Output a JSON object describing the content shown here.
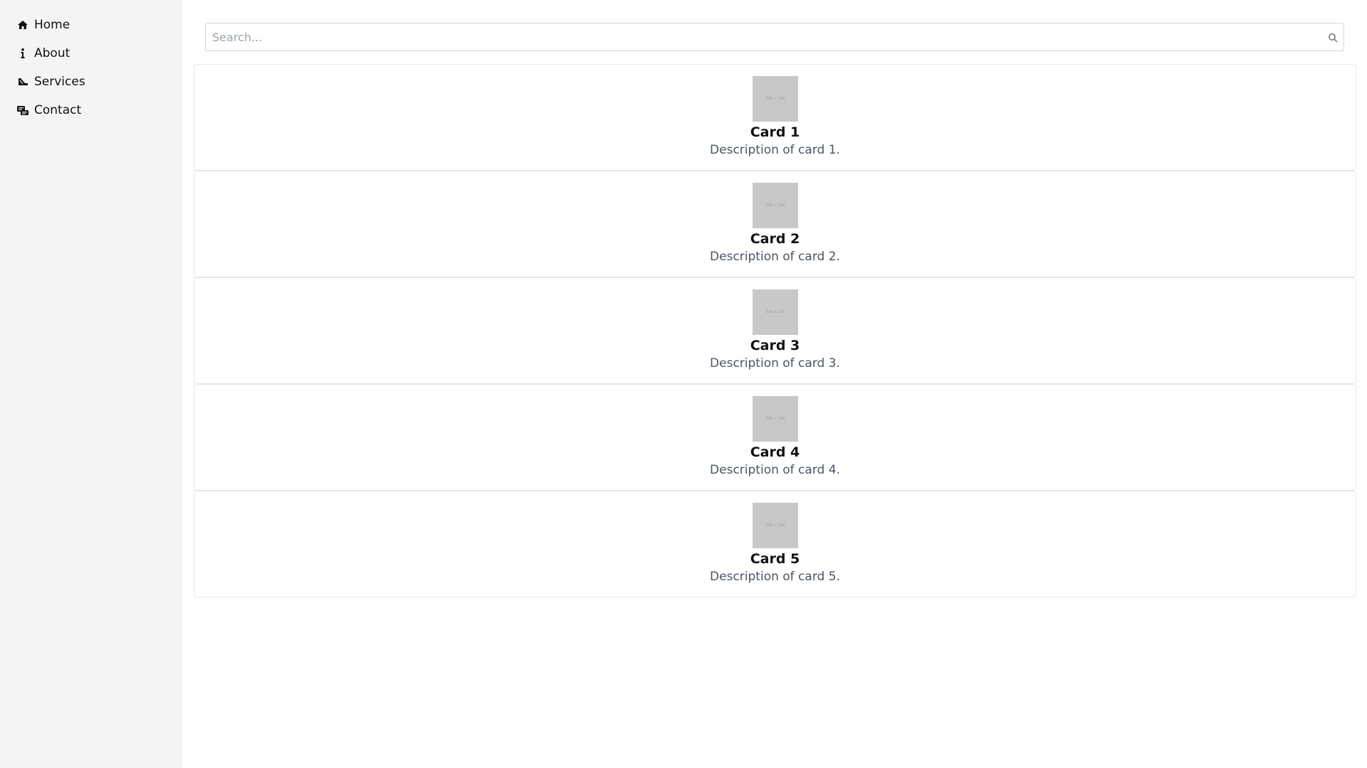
{
  "sidebar": {
    "items": [
      {
        "label": "Home",
        "icon": "home-icon"
      },
      {
        "label": "About",
        "icon": "info-icon"
      },
      {
        "label": "Services",
        "icon": "services-icon"
      },
      {
        "label": "Contact",
        "icon": "contact-icon"
      }
    ]
  },
  "search": {
    "placeholder": "Search...",
    "value": ""
  },
  "cards": [
    {
      "title": "Card 1",
      "description": "Description of card 1.",
      "image_text": "150 × 150"
    },
    {
      "title": "Card 2",
      "description": "Description of card 2.",
      "image_text": "150 × 150"
    },
    {
      "title": "Card 3",
      "description": "Description of card 3.",
      "image_text": "150 × 150"
    },
    {
      "title": "Card 4",
      "description": "Description of card 4.",
      "image_text": "150 × 150"
    },
    {
      "title": "Card 5",
      "description": "Description of card 5.",
      "image_text": "150 × 150"
    }
  ],
  "colors": {
    "sidebar_bg": "#f3f4f6",
    "card_border": "#e5e7eb",
    "placeholder_image": "#c8c8c8",
    "description_text": "#4b5563"
  }
}
